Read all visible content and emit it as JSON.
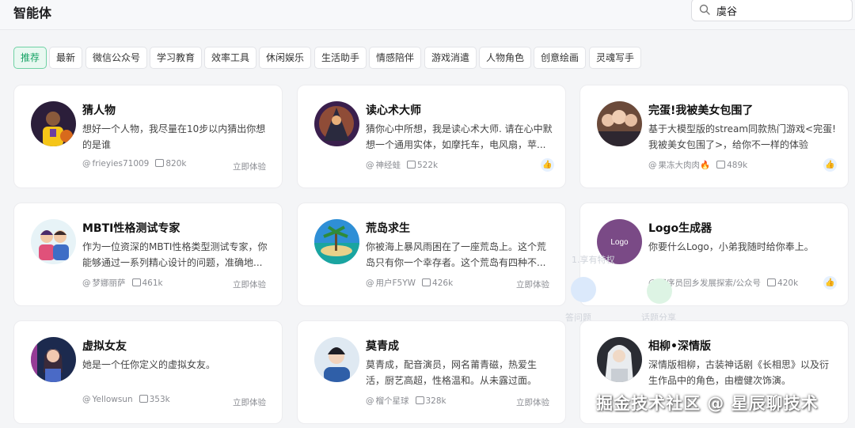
{
  "page": {
    "title": "智能体"
  },
  "search": {
    "value": "虞谷"
  },
  "tabs": [
    {
      "label": "推荐",
      "active": true
    },
    {
      "label": "最新"
    },
    {
      "label": "微信公众号"
    },
    {
      "label": "学习教育"
    },
    {
      "label": "效率工具"
    },
    {
      "label": "休闲娱乐"
    },
    {
      "label": "生活助手"
    },
    {
      "label": "情感陪伴"
    },
    {
      "label": "游戏消遣"
    },
    {
      "label": "人物角色"
    },
    {
      "label": "创意绘画"
    },
    {
      "label": "灵魂写手"
    }
  ],
  "cards": [
    {
      "title": "猜人物",
      "desc": "想好一个人物，我尽量在10步以内猜出你想的是谁",
      "author": "frieyies71009",
      "count": "820k",
      "action": "立即体验",
      "avatar": "basketball-player-avatar"
    },
    {
      "title": "读心术大师",
      "desc": "猜你心中所想，我是读心术大师. 请在心中默想一个通用实体，如摩托车，电风扇，苹...",
      "author": "神经蛙",
      "count": "522k",
      "action": "",
      "avatar": "wizard-avatar"
    },
    {
      "title": "完蛋!我被美女包围了",
      "desc": "基于大模型版的stream同款热门游戏<完蛋!我被美女包围了>，给你不一样的体验",
      "author": "果冻大肉肉🔥",
      "count": "489k",
      "action": "",
      "avatar": "women-group-avatar"
    },
    {
      "title": "MBTI性格测试专家",
      "desc": "作为一位资深的MBTI性格类型测试专家，你能够通过一系列精心设计的问题，准确地...",
      "author": "梦娜丽萨",
      "count": "461k",
      "action": "立即体验",
      "avatar": "couple-cartoon-avatar"
    },
    {
      "title": "荒岛求生",
      "desc": "你被海上暴风雨困在了一座荒岛上。这个荒岛只有你一个幸存者。这个荒岛有四种不...",
      "author": "用户F5YW",
      "count": "426k",
      "action": "立即体验",
      "avatar": "island-avatar"
    },
    {
      "title": "Logo生成器",
      "desc": "你要什么Logo，小弟我随时给你奉上。",
      "author": "程序员回乡发展探索/公众号",
      "count": "420k",
      "action": "",
      "avatar": "logo-avatar",
      "avatar_text": "Logo"
    },
    {
      "title": "虚拟女友",
      "desc": "她是一个任你定义的虚拟女友。",
      "author": "Yellowsun",
      "count": "353k",
      "action": "立即体验",
      "avatar": "virtual-girl-avatar"
    },
    {
      "title": "莫青成",
      "desc": "莫青成，配音演员，网名莆青磁，热爱生活，厨艺高超，性格温和。从未露过面。",
      "author": "榴个星球",
      "count": "328k",
      "action": "立即体验",
      "avatar": "young-man-avatar"
    },
    {
      "title": "相柳•深情版",
      "desc": "深情版相柳，古装神话剧《长相思》以及衍生作品中的角色，由檀健次饰演。",
      "author": "",
      "count": "",
      "action": "",
      "avatar": "ancient-costume-avatar"
    }
  ],
  "ghost": {
    "label1": "1.享有特权",
    "label2": "答问题",
    "label3": "话题分享"
  },
  "watermark": "掘金技术社区 @ 星辰聊技术"
}
